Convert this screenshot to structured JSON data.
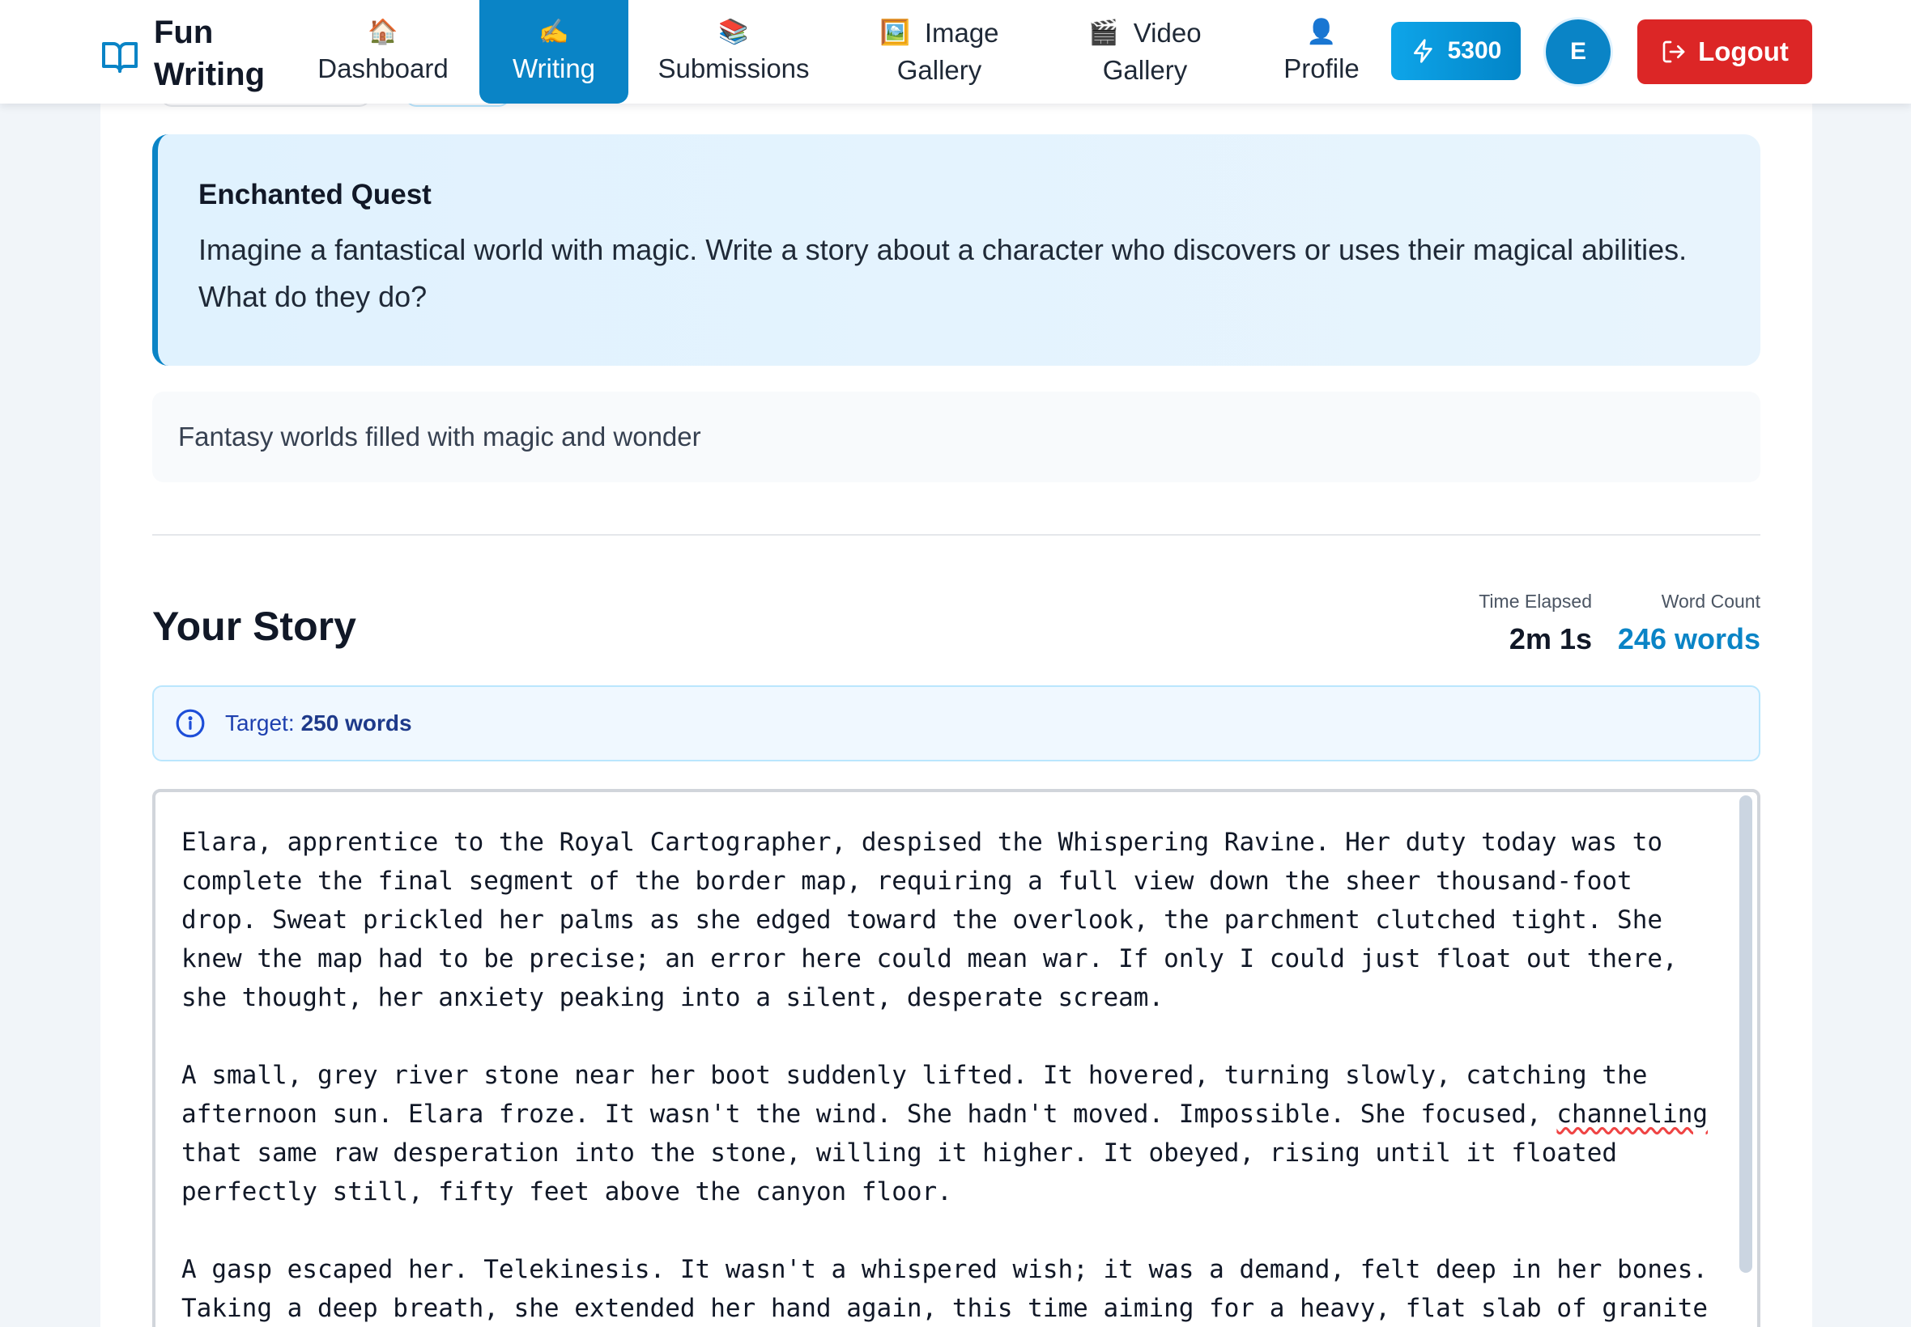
{
  "brand": {
    "name_line1": "Fun",
    "name_line2": "Writing",
    "icon": "open-book-icon"
  },
  "nav": {
    "dashboard": {
      "label": "Dashboard",
      "icon": "🏠"
    },
    "writing": {
      "label": "Writing",
      "icon": "✍️",
      "active": true
    },
    "submissions": {
      "label": "Submissions",
      "icon": "📚"
    },
    "image_gallery": {
      "label1": "Image",
      "label2": "Gallery",
      "icon": "🖼️"
    },
    "video_gallery": {
      "label1": "Video",
      "label2": "Gallery",
      "icon": "🎬"
    },
    "profile": {
      "label": "Profile",
      "icon": "👤"
    }
  },
  "points": {
    "value": "5300",
    "icon": "lightning-icon"
  },
  "avatar": {
    "initial": "E"
  },
  "logout": {
    "label": "Logout",
    "icon": "logout-icon"
  },
  "prompt": {
    "title": "Enchanted Quest",
    "text": "Imagine a fantastical world with magic. Write a story about a character who discovers or uses their magical abilities. What do they do?"
  },
  "category": {
    "description": "Fantasy worlds filled with magic and wonder"
  },
  "story": {
    "heading": "Your Story",
    "time_label": "Time Elapsed",
    "time_value": "2m 1s",
    "words_label": "Word Count",
    "words_value": "246 words",
    "target_label": "Target:",
    "target_value": "250 words"
  },
  "editor": {
    "p1": "Elara, apprentice to the Royal Cartographer, despised the Whispering Ravine. Her duty today was to complete the final segment of the border map, requiring a full view down the sheer thousand-foot drop. Sweat prickled her palms as she edged toward the overlook, the parchment clutched tight. She knew the map had to be precise; an error here could mean war. If only I could just float out there, she thought, her anxiety peaking into a silent, desperate scream.",
    "p2_before": "A small, grey river stone near her boot suddenly lifted. It hovered, turning slowly, catching the afternoon sun. Elara froze. It wasn't the wind. She hadn't moved. Impossible. She focused, ",
    "p2_misspelled": "channeling",
    "p2_after": " that same raw desperation into the stone, willing it higher. It obeyed, rising until it floated perfectly still, fifty feet above the canyon floor.",
    "p3": "A gasp escaped her. Telekinesis. It wasn't a whispered wish; it was a demand, felt deep in her bones. Taking a deep breath, she extended her hand again, this time aiming for a heavy, flat slab of granite"
  },
  "colors": {
    "accent": "#0a84c6",
    "logout": "#dc2626",
    "prompt_bg": "#e0f2fe"
  }
}
